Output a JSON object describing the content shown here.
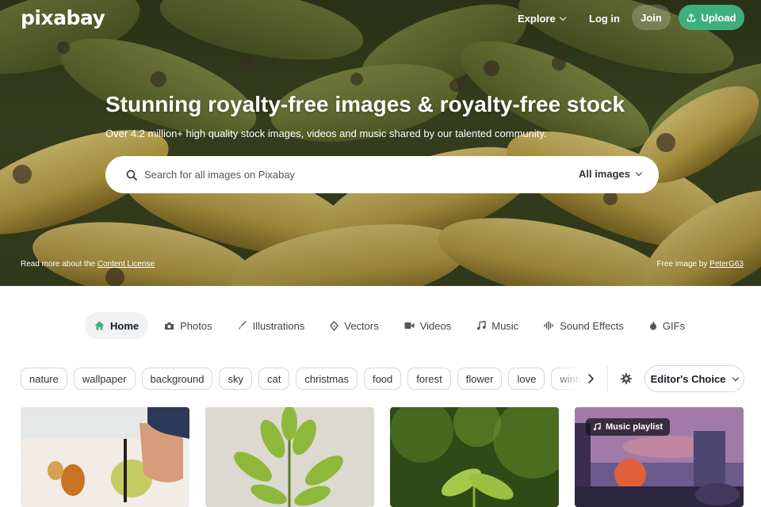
{
  "header": {
    "logo": "pixabay",
    "nav": {
      "explore": "Explore",
      "login": "Log in",
      "join": "Join",
      "upload": "Upload"
    }
  },
  "hero": {
    "title": "Stunning royalty-free images & royalty-free stock",
    "subtitle": "Over 4.2 million+ high quality stock images, videos and music shared by our talented community.",
    "search": {
      "placeholder": "Search for all images on Pixabay",
      "type": "All images"
    },
    "license_text": "Read more about the ",
    "license_link": "Content License",
    "credit_text": "Free image by ",
    "credit_author": "PeterG63"
  },
  "tabs": [
    {
      "label": "Home",
      "icon": "home-icon",
      "active": true
    },
    {
      "label": "Photos",
      "icon": "camera-icon"
    },
    {
      "label": "Illustrations",
      "icon": "brush-icon"
    },
    {
      "label": "Vectors",
      "icon": "pen-nib-icon"
    },
    {
      "label": "Videos",
      "icon": "video-icon"
    },
    {
      "label": "Music",
      "icon": "music-note-icon"
    },
    {
      "label": "Sound Effects",
      "icon": "waveform-icon"
    },
    {
      "label": "GIFs",
      "icon": "flame-icon"
    }
  ],
  "tags": [
    "nature",
    "wallpaper",
    "background",
    "sky",
    "cat",
    "christmas",
    "food",
    "forest",
    "flower",
    "love",
    "winter"
  ],
  "filter": {
    "label": "Editor's Choice"
  },
  "grid": {
    "playlist_badge": "Music playlist"
  },
  "colors": {
    "accent": "#3eaf7c",
    "text": "#191b26",
    "chip_border": "#d6d8dd"
  }
}
